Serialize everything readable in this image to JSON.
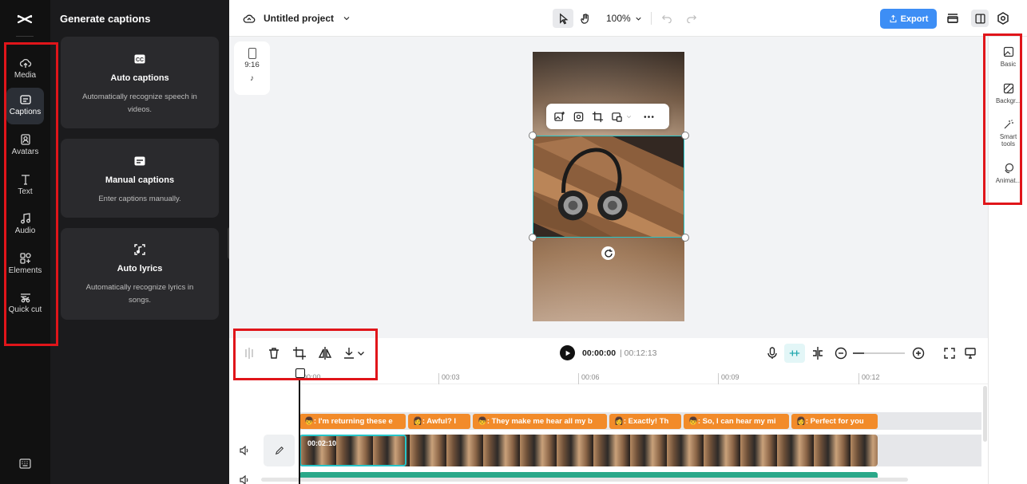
{
  "colors": {
    "accent": "#3d8ef5",
    "caption_clip": "#f28b2a",
    "selection": "#27c4c8",
    "annotation": "#e0151a"
  },
  "rail": {
    "logo": "capcut-logo-icon",
    "items": [
      {
        "label": "Media",
        "icon": "cloud-upload-icon"
      },
      {
        "label": "Captions",
        "icon": "captions-icon"
      },
      {
        "label": "Avatars",
        "icon": "avatar-icon"
      },
      {
        "label": "Text",
        "icon": "text-icon"
      },
      {
        "label": "Audio",
        "icon": "music-note-icon"
      },
      {
        "label": "Elements",
        "icon": "elements-icon"
      },
      {
        "label": "Quick cut",
        "icon": "scissors-icon"
      }
    ],
    "active": "Captions",
    "shortcuts_icon": "keyboard-icon"
  },
  "panel": {
    "title": "Generate captions",
    "cards": [
      {
        "title": "Auto captions",
        "desc": "Automatically recognize speech in videos."
      },
      {
        "title": "Manual captions",
        "desc": "Enter captions manually."
      },
      {
        "title": "Auto lyrics",
        "desc": "Automatically recognize lyrics in songs."
      }
    ]
  },
  "topbar": {
    "project_name": "Untitled project",
    "zoom": "100%",
    "export_label": "Export"
  },
  "preview": {
    "ratio": "9:16",
    "ratio_platform": "tiktok-icon"
  },
  "props": {
    "items": [
      "Basic",
      "Backgr...",
      "Smart tools",
      "Animat..."
    ]
  },
  "timeline": {
    "current_time": "00:00:00",
    "duration": "| 00:12:13",
    "ruler_ticks": [
      "00:00",
      "00:03",
      "00:06",
      "00:09",
      "00:12"
    ],
    "clip_time": "00:02:10",
    "captions": [
      "👦: I'm returning these e",
      "👩: Awful? I",
      "👦: They make me hear all my b",
      "👩: Exactly! Th",
      "👦: So, I can hear my mi",
      "👩: Perfect for you"
    ]
  }
}
